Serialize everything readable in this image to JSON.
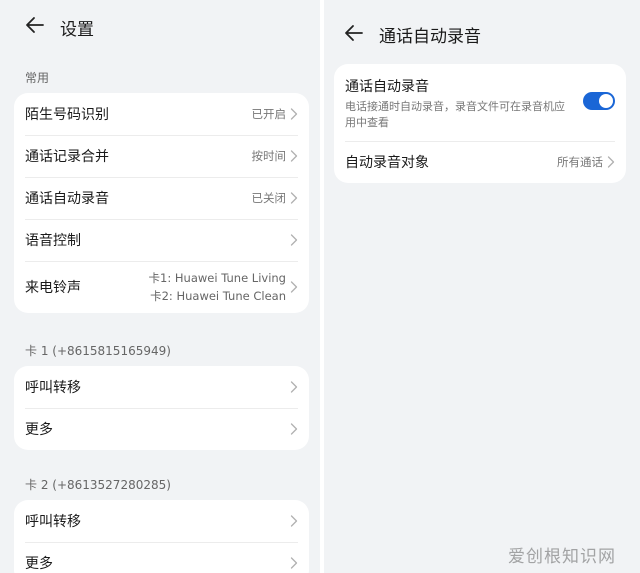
{
  "left": {
    "title": "设置",
    "sections": [
      {
        "label": "常用",
        "items": [
          {
            "label": "陌生号码识别",
            "value": "已开启"
          },
          {
            "label": "通话记录合并",
            "value": "按时间"
          },
          {
            "label": "通话自动录音",
            "value": "已关闭"
          },
          {
            "label": "语音控制",
            "value": ""
          },
          {
            "label": "来电铃声",
            "values": [
              "卡1: Huawei Tune Living",
              "卡2: Huawei Tune Clean"
            ]
          }
        ]
      },
      {
        "label": "卡 1 (+8615815165949)",
        "items": [
          {
            "label": "呼叫转移"
          },
          {
            "label": "更多"
          }
        ]
      },
      {
        "label": "卡 2 (+8613527280285)",
        "items": [
          {
            "label": "呼叫转移"
          },
          {
            "label": "更多"
          }
        ]
      }
    ]
  },
  "right": {
    "title": "通话自动录音",
    "toggle": {
      "title": "通话自动录音",
      "description": "电话接通时自动录音，录音文件可在录音机应用中查看",
      "on": true
    },
    "target": {
      "label": "自动录音对象",
      "value": "所有通话"
    }
  },
  "watermark": "爱创根知识网",
  "colors": {
    "accent": "#1a66d6",
    "background": "#f1f3f5",
    "card": "#ffffff"
  }
}
